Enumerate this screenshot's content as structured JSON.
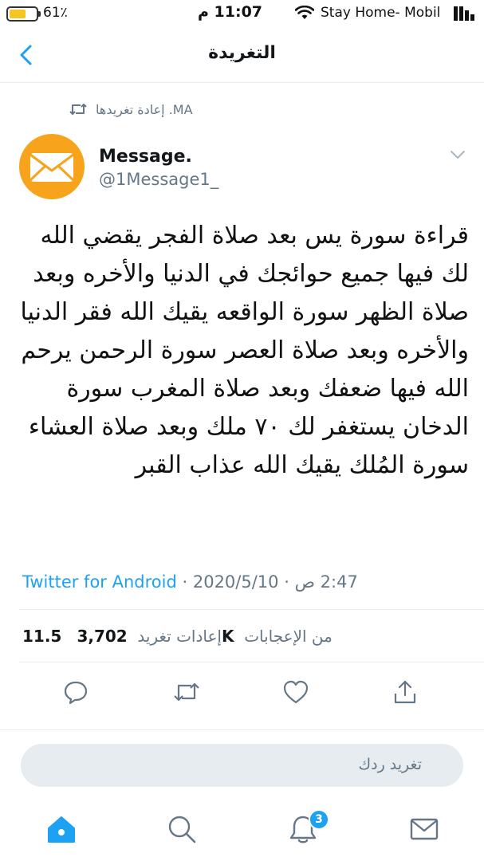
{
  "status_bar": {
    "battery_percent": "61٪",
    "battery_level": 0.61,
    "time": "11:07 م",
    "carrier": "Stay Home- Mobil"
  },
  "header": {
    "title": "التغريدة",
    "back_icon": "chevron-left-icon"
  },
  "retweet_context": {
    "text": "MA. إعادة تغريدها",
    "icon": "retweet-icon"
  },
  "author": {
    "name": "Message.",
    "handle": "@1Message1_",
    "avatar_icon": "envelope-icon",
    "avatar_color": "#f7a41c"
  },
  "tweet": {
    "text": "قراءة سورة يس بعد صلاة الفجر يقضي الله لك فيها جميع حوائجك في الدنيا والأخره وبعد صلاة الظهر سورة الواقعه يقيك الله فقر الدنيا والأخره وبعد صلاة العصر سورة الرحمن يرحم الله فيها ضعفك وبعد صلاة المغرب سورة الدخان يستغفر لك ٧٠ ملك وبعد صلاة العشاء سورة المُلك يقيك الله عذاب القبر"
  },
  "meta": {
    "source": "Twitter for Android",
    "date": "2020/5/10",
    "time": "2:47 ص",
    "separator": " · "
  },
  "stats": {
    "likes_count": "11.5K",
    "likes_label": "من الإعجابات",
    "retweets_count": "3,702",
    "retweets_label": "إعادات تغريد"
  },
  "actions": [
    "reply-icon",
    "retweet-icon",
    "heart-icon",
    "share-icon"
  ],
  "reply": {
    "placeholder": "تغريد ردك"
  },
  "tab_bar": {
    "tabs": [
      "home-icon",
      "search-icon",
      "bell-icon",
      "mail-icon"
    ],
    "notifications_badge": "3"
  },
  "colors": {
    "accent": "#1da1f2",
    "secondary_text": "#657786",
    "divider": "#e6ecf0",
    "battery": "#f5c623"
  }
}
